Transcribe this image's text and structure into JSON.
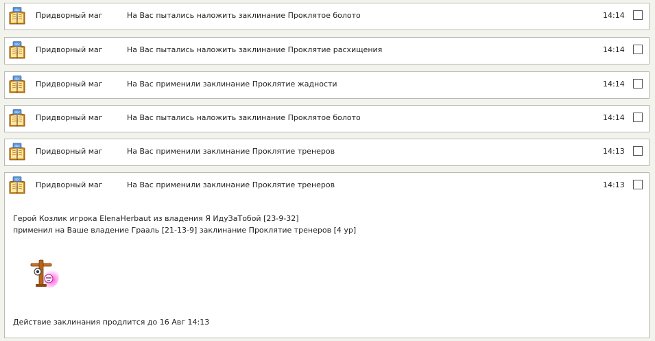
{
  "messages": [
    {
      "sender": "Придворный маг",
      "subject": "На Вас пытались наложить заклинание Проклятое болото",
      "time": "14:14"
    },
    {
      "sender": "Придворный маг",
      "subject": "На Вас пытались наложить заклинание Проклятие расхищения",
      "time": "14:14"
    },
    {
      "sender": "Придворный маг",
      "subject": "На Вас применили заклинание Проклятие жадности",
      "time": "14:14"
    },
    {
      "sender": "Придворный маг",
      "subject": "На Вас пытались наложить заклинание Проклятое болото",
      "time": "14:14"
    },
    {
      "sender": "Придворный маг",
      "subject": "На Вас применили заклинание Проклятие тренеров",
      "time": "14:13"
    },
    {
      "sender": "Придворный маг",
      "subject": "На Вас применили заклинание Проклятие тренеров",
      "time": "14:13"
    }
  ],
  "expanded": {
    "line1": "Герой Козлик игрока ElenaHerbaut из владения Я ИдуЗаТобой [23-9-32]",
    "line2": "применил на Ваше владение Грааль [21-13-9] заклинание Проклятие тренеров [4 ур]",
    "footer": "Действие заклинания продлится до 16 Авг 14:13",
    "spell_icon": "trainer-curse-icon"
  },
  "icons": {
    "book": "spell-book-icon"
  },
  "colors": {
    "background": "#f3f3ee",
    "card": "#ffffff",
    "border": "#b9b9b1"
  }
}
